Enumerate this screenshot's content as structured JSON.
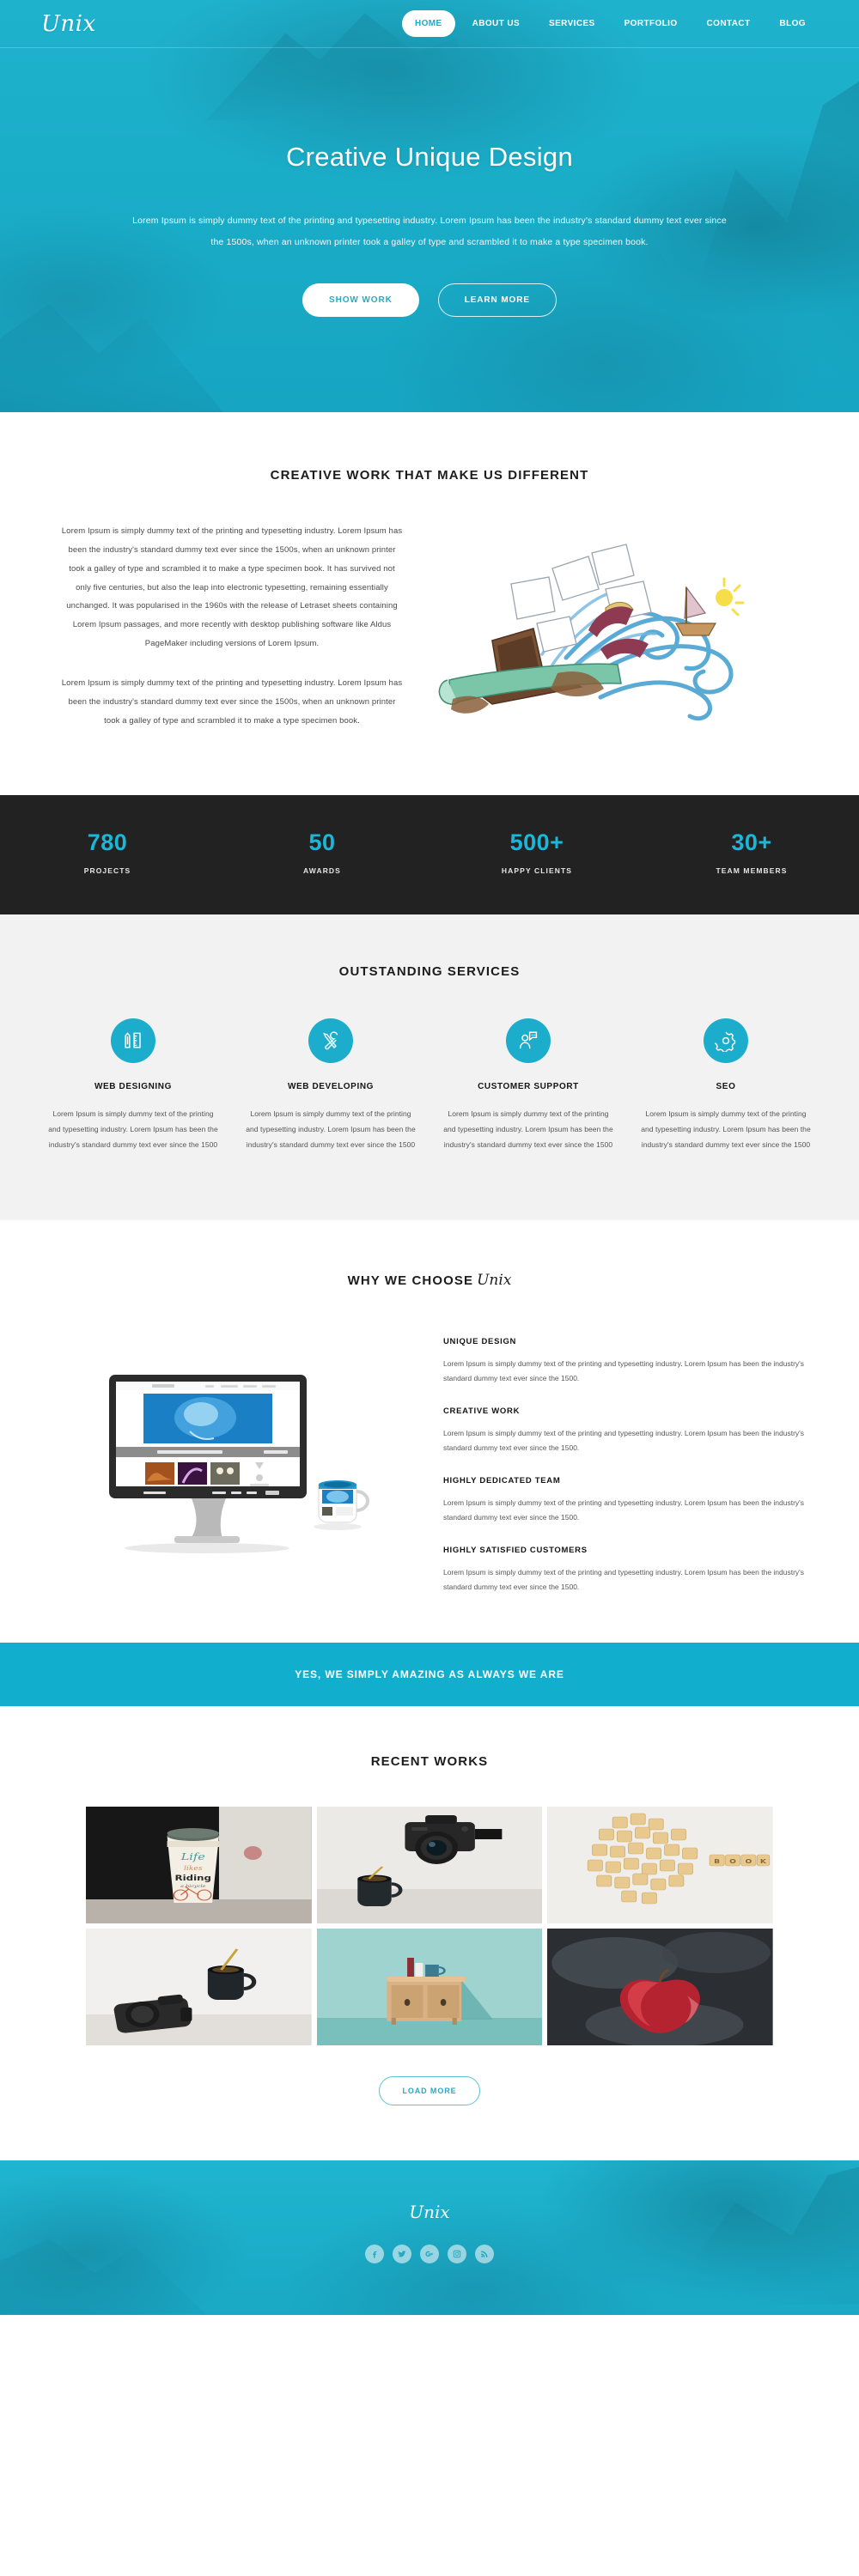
{
  "brand": {
    "name": "Unix"
  },
  "nav": {
    "items": [
      {
        "label": "HOME",
        "active": true
      },
      {
        "label": "ABOUT US",
        "active": false
      },
      {
        "label": "SERVICES",
        "active": false
      },
      {
        "label": "PORTFOLIO",
        "active": false
      },
      {
        "label": "CONTACT",
        "active": false
      },
      {
        "label": "BLOG",
        "active": false
      }
    ]
  },
  "hero": {
    "title": "Creative Unique Design",
    "text": "Lorem Ipsum is simply dummy text of the printing and typesetting industry. Lorem Ipsum has been the industry's standard dummy text ever since the 1500s, when an unknown printer took a galley of type and scrambled it to make a type specimen book.",
    "primary_button": "SHOW WORK",
    "secondary_button": "LEARN MORE"
  },
  "creative": {
    "title": "CREATIVE WORK THAT MAKE US DIFFERENT",
    "paragraph1": "Lorem Ipsum is simply dummy text of the printing and typesetting industry. Lorem Ipsum has been the industry's standard dummy text ever since the 1500s, when an unknown printer took a galley of type and scrambled it to make a type specimen book. It has survived not only five centuries, but also the leap into electronic typesetting, remaining essentially unchanged. It was popularised in the 1960s with the release of Letraset sheets containing Lorem Ipsum passages, and more recently with desktop publishing software like Aldus PageMaker including versions of Lorem Ipsum.",
    "paragraph2": "Lorem Ipsum is simply dummy text of the printing and typesetting industry. Lorem Ipsum has been the industry's standard dummy text ever since the 1500s, when an unknown printer took a galley of type and scrambled it to make a type specimen book.",
    "illustration": "watercolor-laptop-waves-illustration"
  },
  "stats": {
    "items": [
      {
        "number": "780",
        "label": "PROJECTS"
      },
      {
        "number": "50",
        "label": "AWARDS"
      },
      {
        "number": "500+",
        "label": "HAPPY CLIENTS"
      },
      {
        "number": "30+",
        "label": "TEAM MEMBERS"
      }
    ],
    "accent_color": "#19b8d8",
    "background_color": "#222222"
  },
  "services": {
    "title": "OUTSTANDING SERVICES",
    "items": [
      {
        "icon": "pencil-ruler-icon",
        "name": "WEB DESIGNING",
        "desc": "Lorem Ipsum is simply dummy text of the printing and typesetting industry. Lorem Ipsum has been the industry's standard dummy text ever since the 1500"
      },
      {
        "icon": "wrench-screwdriver-icon",
        "name": "WEB DEVELOPING",
        "desc": "Lorem Ipsum is simply dummy text of the printing and typesetting industry. Lorem Ipsum has been the industry's standard dummy text ever since the 1500"
      },
      {
        "icon": "support-agent-icon",
        "name": "CUSTOMER SUPPORT",
        "desc": "Lorem Ipsum is simply dummy text of the printing and typesetting industry. Lorem Ipsum has been the industry's standard dummy text ever since the 1500"
      },
      {
        "icon": "gear-icon",
        "name": "SEO",
        "desc": "Lorem Ipsum is simply dummy text of the printing and typesetting industry. Lorem Ipsum has been the industry's standard dummy text ever since the 1500"
      }
    ],
    "icon_background": "#1cadcc"
  },
  "why": {
    "title_prefix": "WHY WE CHOOSE",
    "title_brand": "Unix",
    "image": "desktop-monitor-with-mug",
    "items": [
      {
        "heading": "UNIQUE DESIGN",
        "text": "Lorem Ipsum is simply dummy text of the printing and typesetting industry. Lorem Ipsum has been the industry's standard dummy text ever since the 1500."
      },
      {
        "heading": "CREATIVE WORK",
        "text": "Lorem Ipsum is simply dummy text of the printing and typesetting industry. Lorem Ipsum has been the industry's standard dummy text ever since the 1500."
      },
      {
        "heading": "HIGHLY DEDICATED TEAM",
        "text": "Lorem Ipsum is simply dummy text of the printing and typesetting industry. Lorem Ipsum has been the industry's standard dummy text ever since the 1500."
      },
      {
        "heading": "HIGHLY SATISFIED CUSTOMERS",
        "text": "Lorem Ipsum is simply dummy text of the printing and typesetting industry. Lorem Ipsum has been the industry's standard dummy text ever since the 1500."
      }
    ]
  },
  "banner": {
    "text": "YES, WE SIMPLY AMAZING AS ALWAYS WE ARE",
    "background_color": "#12aecd"
  },
  "works": {
    "title": "RECENT WORKS",
    "items": [
      {
        "alt": "coffee-cup-life-like-riding-a-bicycle"
      },
      {
        "alt": "dslr-camera-with-black-mug"
      },
      {
        "alt": "alphabet-biscuits-spelling-book"
      },
      {
        "alt": "dslr-camera-and-mug-with-spoon"
      },
      {
        "alt": "wooden-cabinet-with-mugs-teal-wall"
      },
      {
        "alt": "red-apple-on-dark-smoky-background"
      }
    ],
    "load_more_label": "LOAD MORE"
  },
  "footer": {
    "brand": "Unix",
    "socials": [
      {
        "name": "facebook-icon"
      },
      {
        "name": "twitter-icon"
      },
      {
        "name": "google-plus-icon"
      },
      {
        "name": "instagram-icon"
      },
      {
        "name": "rss-icon"
      }
    ]
  },
  "theme": {
    "accent": "#1aacc9",
    "dark": "#222222",
    "light_gray": "#f2f2f2"
  }
}
